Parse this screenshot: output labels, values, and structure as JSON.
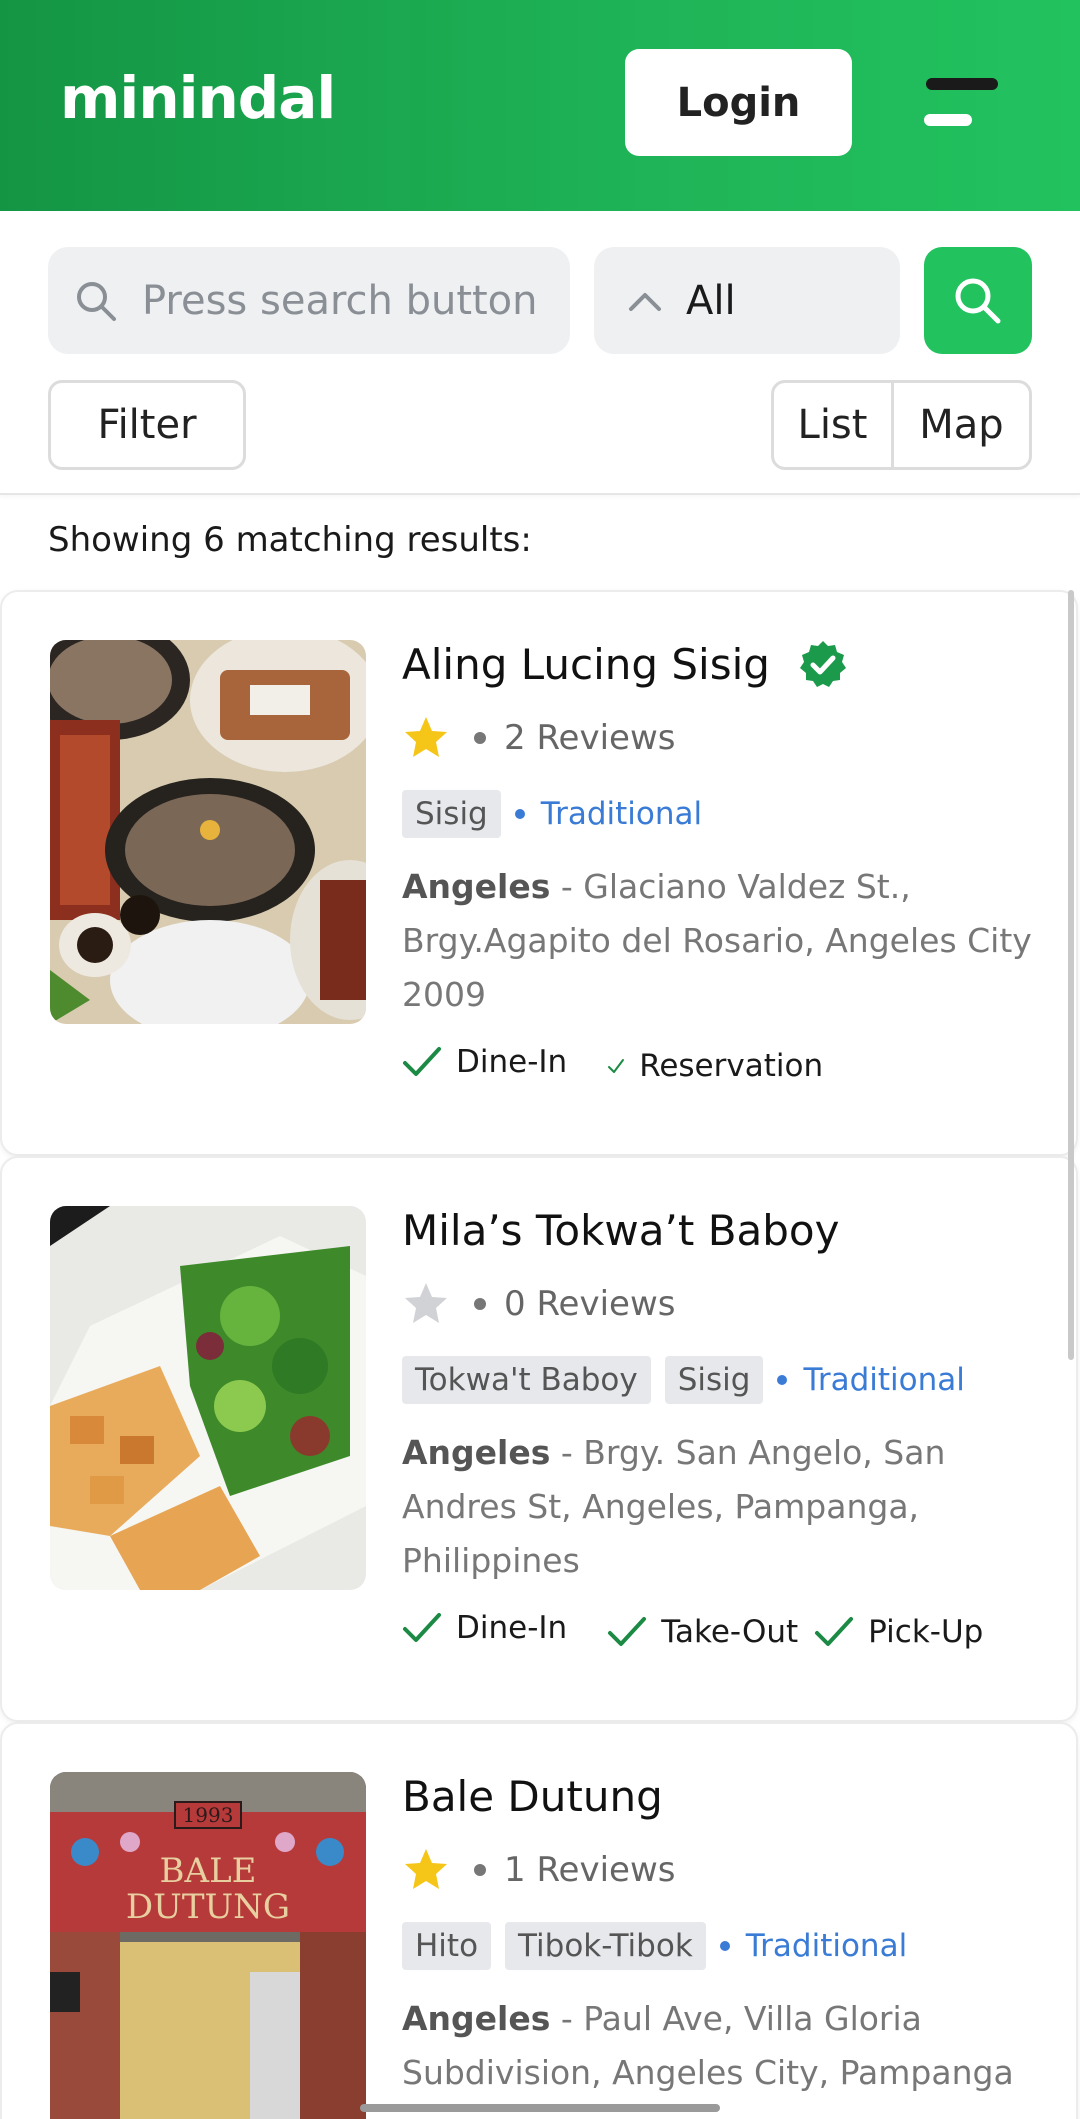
{
  "app": {
    "name": "minindal",
    "accent": "#22c25f"
  },
  "header": {
    "login_label": "Login",
    "menu_icon": "hamburger-menu-icon"
  },
  "search": {
    "placeholder": "Press search button",
    "category_value": "All",
    "filter_label": "Filter",
    "view_list_label": "List",
    "view_map_label": "Map"
  },
  "results": {
    "summary": "Showing 6 matching results:",
    "items": [
      {
        "name": "Aling Lucing Sisig",
        "verified": true,
        "rating_filled": true,
        "reviews": "2 Reviews",
        "tags": [
          "Sisig"
        ],
        "style": "Traditional",
        "city": "Angeles",
        "address": " - Glaciano Valdez St., Brgy.Agapito del Rosario, Angeles City 2009",
        "services": [
          "Dine-In",
          "Reservation"
        ]
      },
      {
        "name": "Mila’s Tokwa’t Baboy",
        "verified": false,
        "rating_filled": false,
        "reviews": "0 Reviews",
        "tags": [
          "Tokwa't Baboy",
          "Sisig"
        ],
        "style": "Traditional",
        "city": "Angeles",
        "address": " - Brgy. San Angelo, San Andres St, Angeles, Pampanga, Philippines",
        "services": [
          "Dine-In",
          "Take-Out",
          "Pick-Up"
        ]
      },
      {
        "name": "Bale Dutung",
        "verified": false,
        "rating_filled": true,
        "reviews": "1 Reviews",
        "tags": [
          "Hito",
          "Tibok-Tibok"
        ],
        "style": "Traditional",
        "city": "Angeles",
        "address": " - Paul Ave, Villa Gloria Subdivision, Angeles City, Pampanga",
        "services": [],
        "sign_text": [
          "1993",
          "BALE",
          "DUTUNG"
        ]
      }
    ]
  }
}
